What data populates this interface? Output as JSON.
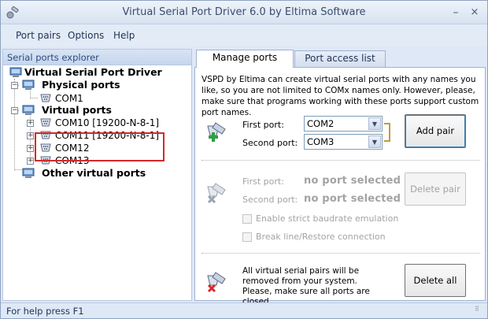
{
  "window": {
    "title": "Virtual Serial Port Driver 6.0 by Eltima Software",
    "minimize_glyph": "–",
    "close_glyph": "×"
  },
  "menu": {
    "items": [
      {
        "label": "Port pairs"
      },
      {
        "label": "Options"
      },
      {
        "label": "Help"
      }
    ]
  },
  "explorer": {
    "header": "Serial ports explorer",
    "root": "Virtual Serial Port Driver",
    "physical_group": "Physical ports",
    "physical_ports": [
      "COM1"
    ],
    "virtual_group": "Virtual ports",
    "virtual_ports": [
      "COM10 [19200-N-8-1]",
      "COM11 [19200-N-8-1]",
      "COM12",
      "COM13"
    ],
    "other_group": "Other virtual ports"
  },
  "tabs": [
    {
      "label": "Manage ports",
      "active": true
    },
    {
      "label": "Port access list",
      "active": false
    }
  ],
  "manage": {
    "description": "VSPD by Eltima can create virtual serial ports with any names you like, so you are not limited to COMx names only. However, please, make sure that programs working with these ports support custom port names.",
    "first_port_label": "First port:",
    "first_port_value": "COM2",
    "second_port_label": "Second port:",
    "second_port_value": "COM3",
    "add_pair_label": "Add pair",
    "del_first_label": "First port:",
    "del_first_value": "no port selected",
    "del_second_label": "Second port:",
    "del_second_value": "no port selected",
    "delete_pair_label": "Delete pair",
    "strict_baud_label": "Enable strict baudrate emulation",
    "break_line_label": "Break line/Restore connection",
    "delete_all_text": "All virtual serial pairs will be removed from your system. Please, make sure all ports are closed.",
    "delete_all_label": "Delete all"
  },
  "status": {
    "text": "For help press F1"
  },
  "colors": {
    "accent": "#2a4a7a",
    "highlight_border": "#d42a2a",
    "disabled_text": "#a3a3a3"
  }
}
